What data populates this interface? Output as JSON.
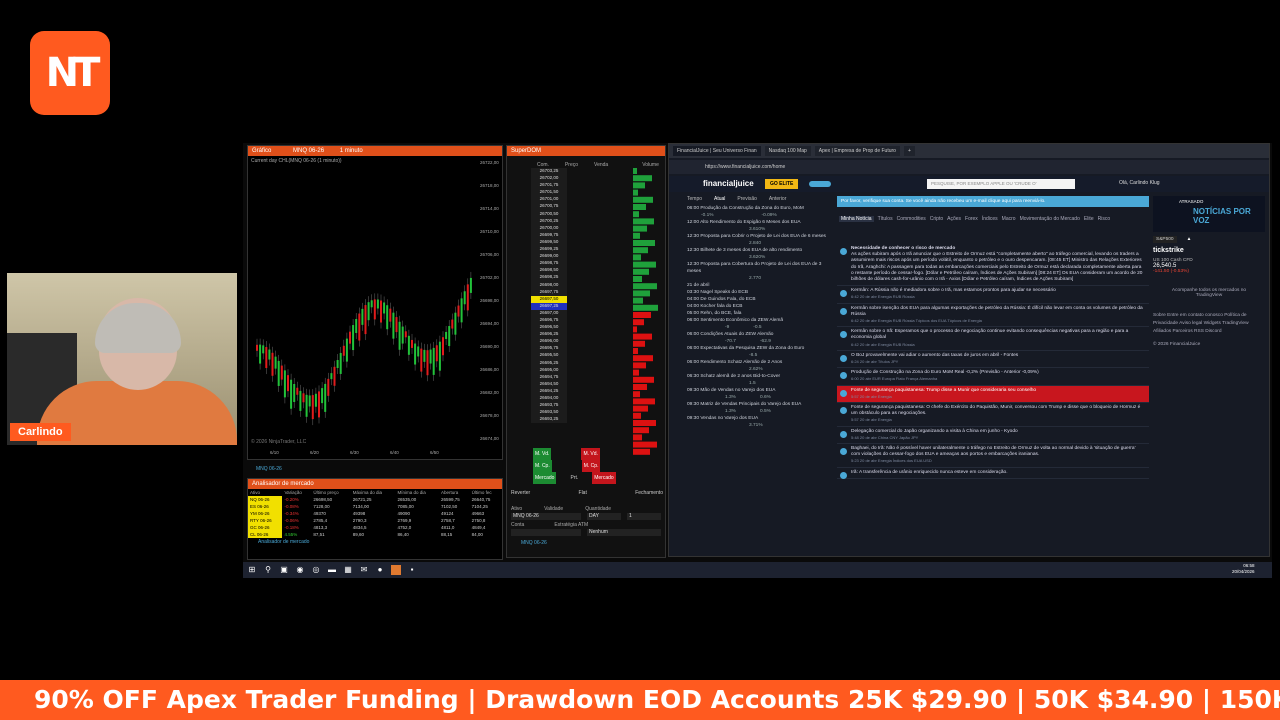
{
  "webcam": {
    "name": "Carlindo"
  },
  "chart": {
    "title": "Gráfico",
    "instrument": "MNQ 06-26",
    "interval": "1 minuto",
    "subtitle": "Current day CHL(MNQ 06-26 (1 minuto))",
    "copyright": "© 2026 NinjaTrader, LLC",
    "tab": "MNQ 06-26",
    "yticks": [
      "26722,00",
      "26718,00",
      "26714,00",
      "26710,00",
      "26706,00",
      "26702,00",
      "26698,00",
      "26694,00",
      "26690,00",
      "26686,00",
      "26682,00",
      "26678,00",
      "26674,00"
    ],
    "xticks": [
      "6/10",
      "6/20",
      "6/30",
      "6/40",
      "6/50"
    ]
  },
  "market": {
    "title": "Analisador de mercado",
    "tab": "Analisador de mercado",
    "headers": [
      "Ativo",
      "Variação",
      "Último preço",
      "Máxima do dia",
      "Mínima do dia",
      "Abertura",
      "Último fec"
    ],
    "rows": [
      [
        "NQ 06-26",
        "-0.20%",
        "26698,50",
        "26721,25",
        "26535,00",
        "26599,75",
        "26640,75"
      ],
      [
        "ES 06-26",
        "-0.08%",
        "7128,00",
        "7134,00",
        "7085,00",
        "7102,50",
        "7104,25"
      ],
      [
        "YM 06-26",
        "-0.34%",
        "49370",
        "49398",
        "49090",
        "49124",
        "49663"
      ],
      [
        "RTY 06-26",
        "-0.06%",
        "2785,4",
        "2790,3",
        "2769,9",
        "2758,7",
        "2750,8"
      ],
      [
        "GC 06-26",
        "-0.18%",
        "4813,3",
        "4834,5",
        "4752,0",
        "4811,0",
        "4849,4"
      ],
      [
        "CL 06-26",
        "4.55%",
        "87,51",
        "89,60",
        "86,40",
        "88,15",
        "84,00"
      ]
    ]
  },
  "dom": {
    "title": "SuperDOM",
    "headers": [
      "Com.",
      "Preço",
      "Venda",
      "Volume"
    ],
    "prices": [
      "26703,25",
      "26702,00",
      "26701,75",
      "26701,50",
      "26701,00",
      "26700,75",
      "26700,50",
      "26700,25",
      "26700,00",
      "26699,75",
      "26699,50",
      "26699,25",
      "26699,00",
      "26698,75",
      "26698,50",
      "26698,25",
      "26698,00",
      "26697,75",
      "26697,50",
      "26697,25",
      "26697,00",
      "26696,75",
      "26696,50",
      "26696,25",
      "26696,00",
      "26695,75",
      "26695,50",
      "26695,25",
      "26695,00",
      "26694,75",
      "26694,50",
      "26694,25",
      "26694,00",
      "26693,75",
      "26693,50",
      "26693,25"
    ],
    "buttons": [
      "M. Vd.",
      "M. Cp.",
      "Mercado",
      "Prt.",
      "Reverter",
      "Flat",
      "Fechamento"
    ],
    "fields": {
      "asset_label": "Ativo",
      "asset": "MNQ 06-26",
      "validity_label": "Validade",
      "validity": "DAY",
      "qty_label": "Quantidade",
      "qty": "1",
      "account_label": "Conta",
      "strategy_label": "Estratégia ATM",
      "strategy": "Nenhum"
    },
    "tab": "MNQ 06-26"
  },
  "browser": {
    "tabs": [
      "FinancialJuice | Seu Universo Finan",
      "Nasdaq 100 Map",
      "Apex | Empresa de Prop de Futuro"
    ],
    "url": "https://www.financialjuice.com/home"
  },
  "fj": {
    "logo": "financialjuice",
    "go_elite": "GO ELITE",
    "search": "PESQUISE, POR EXEMPLO APPLE OU 'CRUDE O'",
    "user": "Olá, Carlindo Klug",
    "banner": "Por favor, verifique sua conta. Se você ainda não recebeu um e-mail clique aqui para reenviá-lo.",
    "filters": [
      "Minha Notícia",
      "Títulos",
      "Commodities",
      "Cripto",
      "Ações",
      "Forex",
      "Índices",
      "Macro",
      "Movimentação do Mercado",
      "Elite",
      "Risco"
    ],
    "cal_head": [
      "Tempo",
      "Atual",
      "Previsão",
      "Anterior"
    ],
    "calendar": [
      {
        "t": "06:00",
        "name": "Produção da Construção da Zona do Euro, MoM",
        "a": "-0.1%",
        "f": "",
        "p": "-0.09%"
      },
      {
        "t": "12:00",
        "name": "Alto Rendimento do Espigão 6 Meses dos EUA",
        "a": "",
        "f": "",
        "p": "3.610%"
      },
      {
        "t": "12:30",
        "name": "Proposta para Cobrir o Projeto de Lei dos EUA de 6 meses",
        "a": "",
        "f": "",
        "p": "2.840"
      },
      {
        "t": "12:30",
        "name": "Bilhete de 3 meses dos EUA de alto rendimento",
        "a": "",
        "f": "",
        "p": "3.620%"
      },
      {
        "t": "12:30",
        "name": "Proposta para Cobertura do Projeto de Lei dos EUA de 3 meses",
        "a": "",
        "f": "",
        "p": "2.770"
      },
      {
        "t": "21 de abril",
        "name": "",
        "a": "",
        "f": "",
        "p": ""
      },
      {
        "t": "03:30",
        "name": "Nagel Speaks do ECB",
        "a": "",
        "f": "",
        "p": ""
      },
      {
        "t": "04:00",
        "name": "De Guindos Fala, do ECB",
        "a": "",
        "f": "",
        "p": ""
      },
      {
        "t": "04:00",
        "name": "Kocher fala do ECB",
        "a": "",
        "f": "",
        "p": ""
      },
      {
        "t": "05:00",
        "name": "Rehn, do BCE, fala",
        "a": "",
        "f": "",
        "p": ""
      },
      {
        "t": "06:00",
        "name": "Sentimento Econômico da ZEW Alemã",
        "a": "",
        "f": "-9",
        "p": "-0.5"
      },
      {
        "t": "06:00",
        "name": "Condições Atuais do ZEW Alemão",
        "a": "",
        "f": "-70.7",
        "p": "-62.9"
      },
      {
        "t": "06:00",
        "name": "Expectativas da Pesquisa ZEW da Zona do Euro",
        "a": "",
        "f": "",
        "p": "-8.5"
      },
      {
        "t": "06:00",
        "name": "Rendimento Schatz Alemão de 2 Anos",
        "a": "",
        "f": "",
        "p": "2.62%"
      },
      {
        "t": "06:30",
        "name": "Schatz alemã de 2 anos Bid-to-Cover",
        "a": "",
        "f": "",
        "p": "1.5"
      },
      {
        "t": "09:30",
        "name": "Mão de Vendas no Varejo dos EUA",
        "a": "",
        "f": "1.3%",
        "p": "0.6%"
      },
      {
        "t": "09:30",
        "name": "Matriz de Vendas Principais do Varejo dos EUA",
        "a": "",
        "f": "1.3%",
        "p": "0.5%"
      },
      {
        "t": "09:30",
        "name": "Vendas no Varejo dos EUA",
        "a": "",
        "f": "",
        "p": "3.71%"
      }
    ],
    "news": [
      {
        "title": "Necessidade de conhecer o risco de mercado",
        "body": "As ações subiram após o Irã anunciar que o Estreito de Ormuz está \"completamente aberto\" ao tráfego comercial, levando os traders a assumirem mais riscos após um período volátil, enquanto o petróleo e o ouro despencaram. [08:45 ET] Ministro das Relações Exteriores do Irã, Araghchi: A passagem para todas as embarcações comerciais pelo Estreito de Ormuz está declarada completamente aberta para o restante período de cessar-fogo. [Dólar e Petróleo caíram, Índices de Ações Subiram] [08:24 ET] Os EUA consideram um acordo de 20 bilhões de dólares cash-for-urânio com o Irã - Axios [Dólar e Petróleo caíram, Índices de Ações Subiram]",
        "meta": ""
      },
      {
        "title": "Kermân: A Rússia não é mediadora sobre o Irã, mas estamos prontos para ajudar se necessário",
        "body": "",
        "meta": "6:42 20 de abr  Energia  RUB  Rússia"
      },
      {
        "title": "Kermân sobre isenção dos EUA para algumas exportações de petróleo da Rússia: É difícil não levar em conta os volumes de petróleo da Rússia",
        "body": "",
        "meta": "6:42 20 de abr  Energia  RUB  Rússia  Tópicos dos EUA  Tópicos de Energia"
      },
      {
        "title": "Kermân sobre o Irã: Esperamos que o processo de negociação continue evitando consequências negativas para a região e para a economia global",
        "body": "",
        "meta": "6:42 20 de abr  Energia  RUB  Rússia"
      },
      {
        "title": "O BoJ provavelmente vai adiar o aumento das taxas de juros em abril - Fontes",
        "body": "",
        "meta": "6:24 20 de abr  Títulos  JPY"
      },
      {
        "title": "Produção de Construção na Zona do Euro MoM Real -0,2% (Previsão - Anterior -0,09%)",
        "body": "",
        "meta": "6:00 20 abr  EUR  Europa  Fiato  França  Alemanha"
      },
      {
        "title": "Fonte de segurança paquistanesa: Trump disse a Munir que consideraria seu conselho",
        "body": "",
        "meta": "5:57 20 de abr  Energia",
        "red": true
      },
      {
        "title": "Fonte de segurança paquistanesa: O chefe do Exército do Paquistão, Munir, conversou com Trump e disse que o bloqueio de Hormuz é um obstáculo para as negociações.",
        "body": "",
        "meta": "5:57 20 de abr  Energia"
      },
      {
        "title": "Delegação comercial do Japão organizando a visita à China em junho - Kyodo",
        "body": "",
        "meta": "5:48 20 de abr  China  CNY  Japão  JPY"
      },
      {
        "title": "Baghaei, do Irã: Não é possível haver unilateralmente o tráfego no Estreito de Ormuz de volta ao normal devido à 'situação de guerra' com violações do cessar-fogo dos EUA e ameaças aos portos e embarcações iranianas.",
        "body": "",
        "meta": "5:23 20 de abr  Energia  Índices dos EUA  USD"
      },
      {
        "title": "Irã: A transferência de urânio enriquecido nunca esteve em consideração.",
        "body": "",
        "meta": ""
      }
    ],
    "side": {
      "delayed": "ATRASADO",
      "banner": "NOTÍCIAS POR VOZ",
      "select": "S&P500",
      "brand": "tickstrike",
      "q1_name": "US 100 Cash CFD",
      "q1_val": "26,540.5",
      "q1_chg": "-141.50 (-0.53%)",
      "track": "Acompanhe todos os mercados no",
      "tv": "TradingView",
      "links": "Sobre  Entre em contato conosco  Política de Privacidade  Aviso legal  Widgets  TradingView  Afiliados  Parceiros  RSS  Discord",
      "copy": "© 2026 FinancialJuice"
    }
  },
  "clock": {
    "time": "06:58",
    "date": "20/04/2026"
  },
  "ticker": "90% OFF Apex Trader Funding | Drawdown EOD Accounts 25K $29.90 | 50K $34.90 | 150K $79.90 - Co"
}
